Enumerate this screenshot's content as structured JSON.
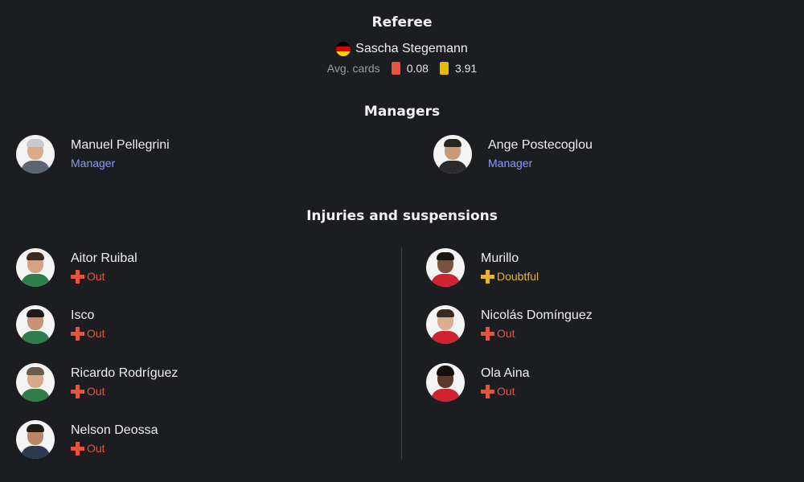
{
  "referee": {
    "title": "Referee",
    "name": "Sascha Stegemann",
    "flag": "germany-flag-icon",
    "avg_label": "Avg. cards",
    "red_avg": "0.08",
    "yellow_avg": "3.91",
    "red_color": "#e4553f",
    "yellow_color": "#e8b900"
  },
  "managers": {
    "title": "Managers",
    "home": {
      "name": "Manuel Pellegrini",
      "role": "Manager"
    },
    "away": {
      "name": "Ange Postecoglou",
      "role": "Manager"
    }
  },
  "injuries": {
    "title": "Injuries and suspensions",
    "home": [
      {
        "name": "Aitor Ruibal",
        "status": "Out"
      },
      {
        "name": "Isco",
        "status": "Out"
      },
      {
        "name": "Ricardo Rodríguez",
        "status": "Out"
      },
      {
        "name": "Nelson Deossa",
        "status": "Out"
      }
    ],
    "away": [
      {
        "name": "Murillo",
        "status": "Doubtful"
      },
      {
        "name": "Nicolás Domínguez",
        "status": "Out"
      },
      {
        "name": "Ola Aina",
        "status": "Out"
      }
    ]
  },
  "colors": {
    "background": "#1b1d20",
    "role_accent": "#8f98ff",
    "out": "#e4553f",
    "doubtful": "#e8b13a"
  }
}
